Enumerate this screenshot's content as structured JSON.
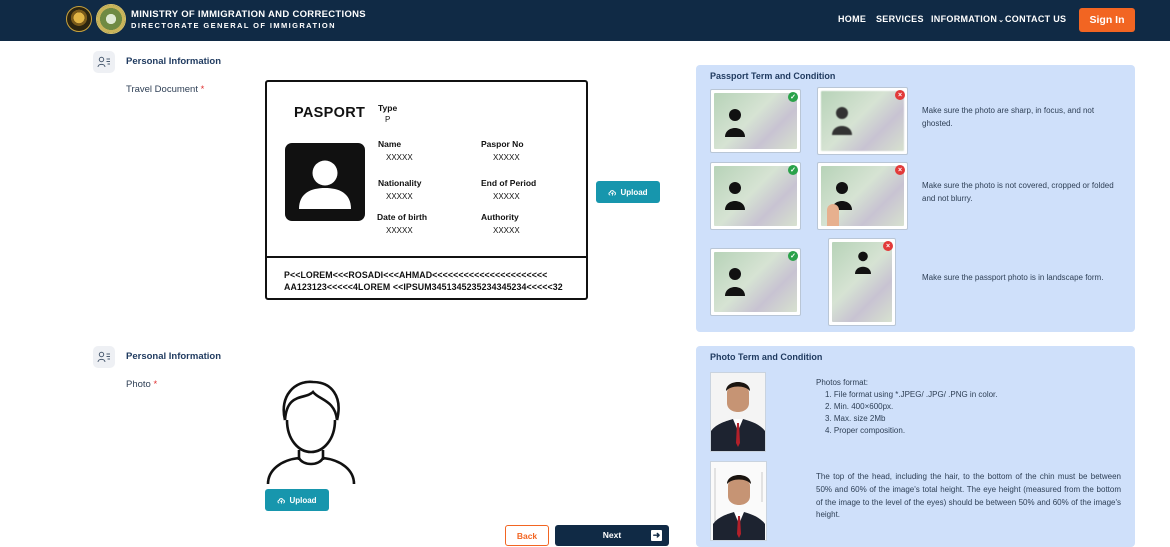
{
  "header": {
    "title_line1": "MINISTRY OF IMMIGRATION AND CORRECTIONS",
    "title_line2": "DIRECTORATE GENERAL OF IMMIGRATION",
    "nav": [
      "HOME",
      "SERVICES",
      "INFORMATION",
      "CONTACT US"
    ],
    "signin_label": "Sign In",
    "accent": "#f26522",
    "bg": "#102a45"
  },
  "section1": {
    "title": "Personal Information",
    "field_label": "Travel Document",
    "required_mark": "*"
  },
  "passport": {
    "title": "PASPORT",
    "type_label": "Type",
    "type_value": "P",
    "name_label": "Name",
    "name_value": "XXXXX",
    "passport_no_label": "Paspor No",
    "passport_no_value": "XXXXX",
    "nationality_label": "Nationality",
    "nationality_value": "XXXXX",
    "end_label": "End of Period",
    "end_value": "XXXXX",
    "dob_label": "Date of birth",
    "dob_value": "XXXXX",
    "authority_label": "Authority",
    "authority_value": "XXXXX",
    "mrz_line1": "P<<LOREM<<<ROSADI<<<AHMAD<<<<<<<<<<<<<<<<<<<<<<",
    "mrz_line2": "AA123123<<<<<4LOREM <<IPSUM3451345235234345234<<<<<32"
  },
  "upload_label": "Upload",
  "passport_terms": {
    "title": "Passport Term and Condition",
    "rules": [
      "Make sure the photo are sharp, in focus, and not ghosted.",
      "Make sure the photo is not covered, cropped or folded and not blurry.",
      "Make sure the passport photo is in landscape form."
    ]
  },
  "section2": {
    "title": "Personal Information",
    "field_label": "Photo",
    "required_mark": "*"
  },
  "photo_terms": {
    "title": "Photo Term and Condition",
    "format_heading": "Photos format:",
    "format_items": [
      "1. File format using *.JPEG/ .JPG/ .PNG in color.",
      "2. Min. 400×600px.",
      "3. Max. size 2Mb",
      "4. Proper composition."
    ],
    "height_rule": "The top of the head, including the hair, to the bottom of the chin must be between 50% and 60% of the image's total height. The eye height (measured from the bottom of the image to the level of the eyes) should be between 50% and 60% of the image's height."
  },
  "footer": {
    "back_label": "Back",
    "next_label": "Next"
  }
}
